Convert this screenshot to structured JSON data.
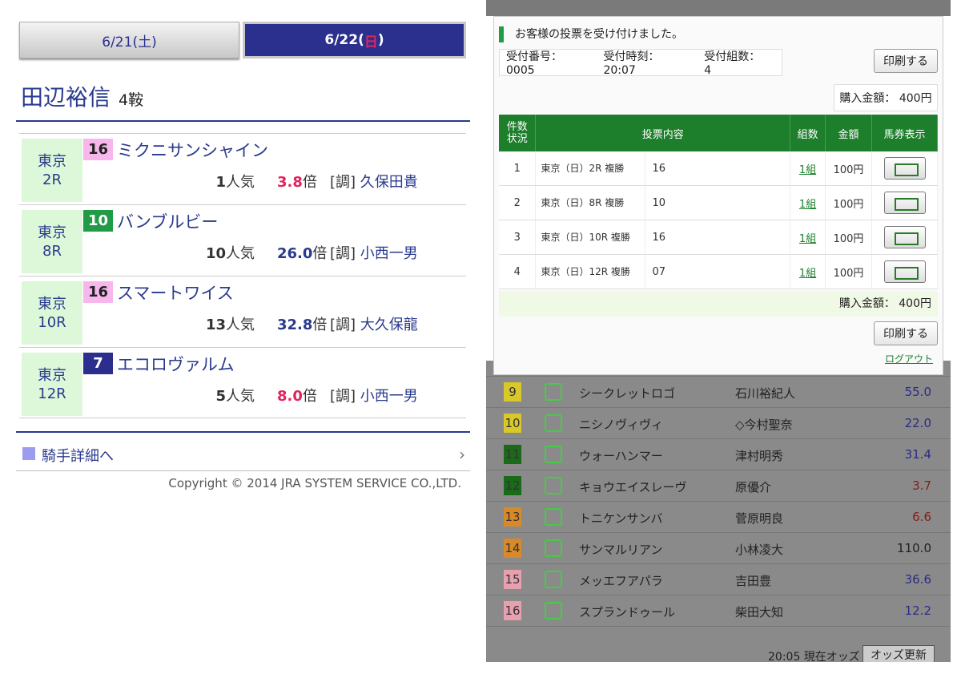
{
  "left": {
    "tabs": [
      {
        "label": "6/21(土)"
      },
      {
        "label_main": "6/22(",
        "label_day": "日",
        "label_end": ")"
      }
    ],
    "jockey": {
      "name": "田辺裕信",
      "wins": "4鞍"
    },
    "races": [
      {
        "venue": "東京",
        "race": "2R",
        "horse_no": "16",
        "horse_name": "ミクニサンシャイン",
        "pop_num": "1",
        "pop_unit": "人気",
        "odds": "3.8",
        "odds_unit": "倍",
        "trainer_tag": "[調]",
        "trainer": "久保田貴"
      },
      {
        "venue": "東京",
        "race": "8R",
        "horse_no": "10",
        "horse_name": "バンブルビー",
        "pop_num": "10",
        "pop_unit": "人気",
        "odds": "26.0",
        "odds_unit": "倍",
        "trainer_tag": "[調]",
        "trainer": "小西一男"
      },
      {
        "venue": "東京",
        "race": "10R",
        "horse_no": "16",
        "horse_name": "スマートワイス",
        "pop_num": "13",
        "pop_unit": "人気",
        "odds": "32.8",
        "odds_unit": "倍",
        "trainer_tag": "[調]",
        "trainer": "大久保龍"
      },
      {
        "venue": "東京",
        "race": "12R",
        "horse_no": "7",
        "horse_name": "エコロヴァルム",
        "pop_num": "5",
        "pop_unit": "人気",
        "odds": "8.0",
        "odds_unit": "倍",
        "trainer_tag": "[調]",
        "trainer": "小西一男"
      }
    ],
    "detail_link": "騎手詳細へ",
    "copyright": "Copyright © 2014 JRA SYSTEM SERVICE CO.,LTD."
  },
  "right": {
    "modal": {
      "heading": "お客様の投票を受け付けました。",
      "receipt_no": "受付番号： 0005",
      "receipt_time": "受付時刻： 20:07",
      "receipt_count": "受付組数： 4",
      "print_label": "印刷する",
      "total_label": "購入金額： 400円",
      "table_headers": {
        "status": "件数\n状況",
        "content": "投票内容",
        "sets": "組数",
        "amount": "金額",
        "ticket": "馬券表示"
      },
      "bets": [
        {
          "no": "1",
          "race": "東京（日）2R 複勝",
          "horse": "16",
          "sets": "1組",
          "amount": "100円"
        },
        {
          "no": "2",
          "race": "東京（日）8R 複勝",
          "horse": "10",
          "sets": "1組",
          "amount": "100円"
        },
        {
          "no": "3",
          "race": "東京（日）10R 複勝",
          "horse": "16",
          "sets": "1組",
          "amount": "100円"
        },
        {
          "no": "4",
          "race": "東京（日）12R 複勝",
          "horse": "07",
          "sets": "1組",
          "amount": "100円"
        }
      ],
      "table_total": "購入金額： 400円",
      "print_label_2": "印刷する",
      "logout": "ログアウト"
    },
    "odds_rows": [
      {
        "no": "9",
        "frame_color": "#d8c82a",
        "horse": "シークレットロゴ",
        "jockey": "石川裕紀人",
        "odds": "55.0",
        "odds_color": "#2a2a8a"
      },
      {
        "no": "10",
        "frame_color": "#d8c82a",
        "horse": "ニシノヴィヴィ",
        "jockey": "◇今村聖奈",
        "odds": "22.0",
        "odds_color": "#2a2a8a"
      },
      {
        "no": "11",
        "frame_color": "#1a6a1a",
        "horse": "ウォーハンマー",
        "jockey": "津村明秀",
        "odds": "31.4",
        "odds_color": "#2a2a8a"
      },
      {
        "no": "12",
        "frame_color": "#1a6a1a",
        "horse": "キョウエイスレーヴ",
        "jockey": "原優介",
        "odds": "3.7",
        "odds_color": "#8a1a1a"
      },
      {
        "no": "13",
        "frame_color": "#d88a2a",
        "horse": "トニケンサンバ",
        "jockey": "菅原明良",
        "odds": "6.6",
        "odds_color": "#8a1a1a"
      },
      {
        "no": "14",
        "frame_color": "#d88a2a",
        "horse": "サンマルリアン",
        "jockey": "小林凌大",
        "odds": "110.0",
        "odds_color": "#222222"
      },
      {
        "no": "15",
        "frame_color": "#e8a0b0",
        "horse": "メッエフアパラ",
        "jockey": "吉田豊",
        "odds": "36.6",
        "odds_color": "#2a2a8a"
      },
      {
        "no": "16",
        "frame_color": "#e8a0b0",
        "horse": "スプランドゥール",
        "jockey": "柴田大知",
        "odds": "12.2",
        "odds_color": "#2a2a8a"
      }
    ],
    "odds_footer": {
      "time": "20:05 現在オッズ",
      "button": "オッズ更新"
    }
  }
}
